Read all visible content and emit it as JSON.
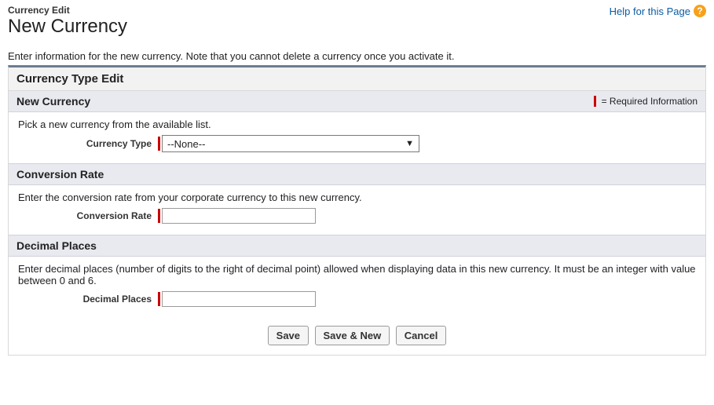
{
  "header": {
    "breadcrumb": "Currency Edit",
    "title": "New Currency",
    "help_link": "Help for this Page"
  },
  "intro": "Enter information for the new currency. Note that you cannot delete a currency once you activate it.",
  "panel_title": "Currency Type Edit",
  "required_note": "= Required Information",
  "sections": {
    "currency": {
      "heading": "New Currency",
      "desc": "Pick a new currency from the available list.",
      "field_label": "Currency Type",
      "selected": "--None--"
    },
    "rate": {
      "heading": "Conversion Rate",
      "desc": "Enter the conversion rate from your corporate currency to this new currency.",
      "field_label": "Conversion Rate",
      "value": ""
    },
    "decimals": {
      "heading": "Decimal Places",
      "desc": "Enter decimal places (number of digits to the right of decimal point) allowed when displaying data in this new currency. It must be an integer with value between 0 and 6.",
      "field_label": "Decimal Places",
      "value": ""
    }
  },
  "buttons": {
    "save": "Save",
    "save_new": "Save & New",
    "cancel": "Cancel"
  }
}
